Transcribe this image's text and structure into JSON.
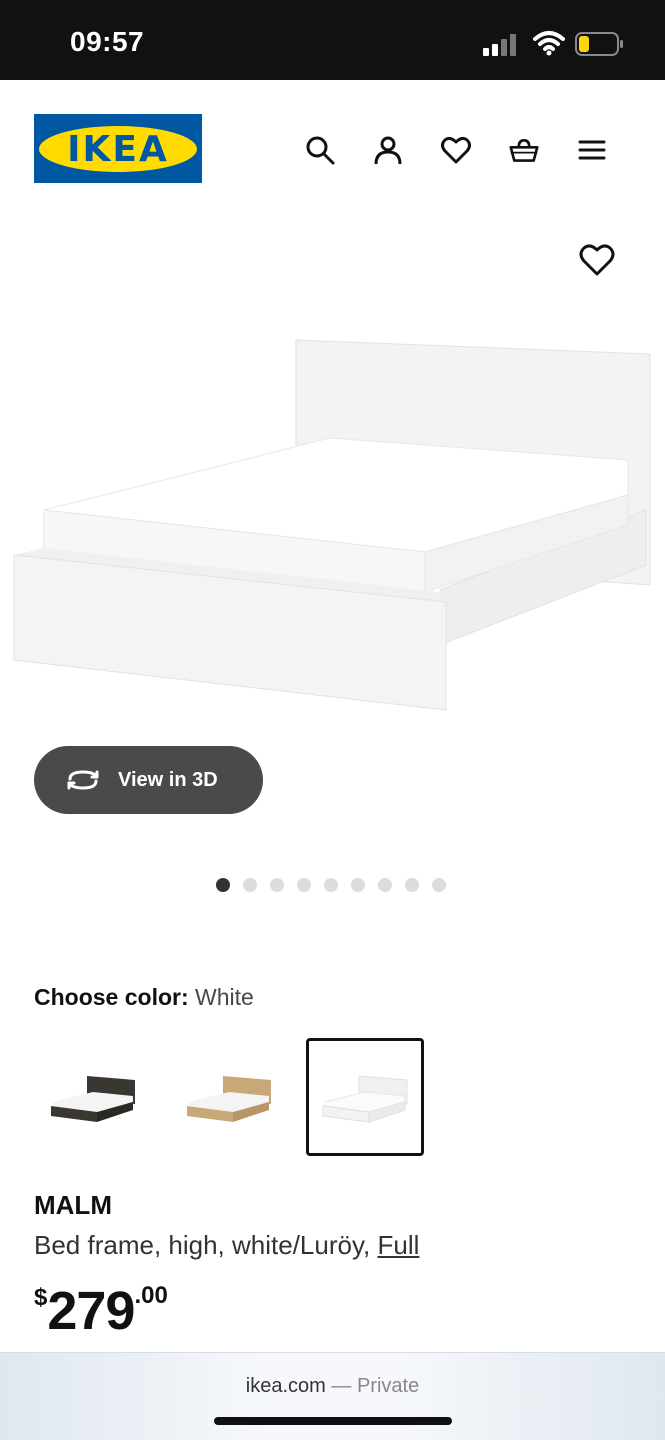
{
  "status_bar": {
    "time": "09:57"
  },
  "header": {
    "logo_text": "IKEA",
    "icons": [
      "search-icon",
      "account-icon",
      "heart-icon",
      "basket-icon",
      "menu-icon"
    ]
  },
  "gallery": {
    "view3d_label": "View in 3D",
    "image_count": 9,
    "active_index": 0
  },
  "color_picker": {
    "label": "Choose color:",
    "selected": "White",
    "options": [
      "black-brown",
      "oak veneer",
      "white"
    ]
  },
  "product": {
    "name": "MALM",
    "description": "Bed frame, high, white/Luröy,",
    "size_link": "Full",
    "price_currency": "$",
    "price_int": "279",
    "price_dec": ".00"
  },
  "browser": {
    "domain": "ikea.com",
    "mode": "— Private"
  },
  "colors": {
    "ikea_blue": "#0058a3",
    "ikea_yellow": "#ffdb00"
  }
}
